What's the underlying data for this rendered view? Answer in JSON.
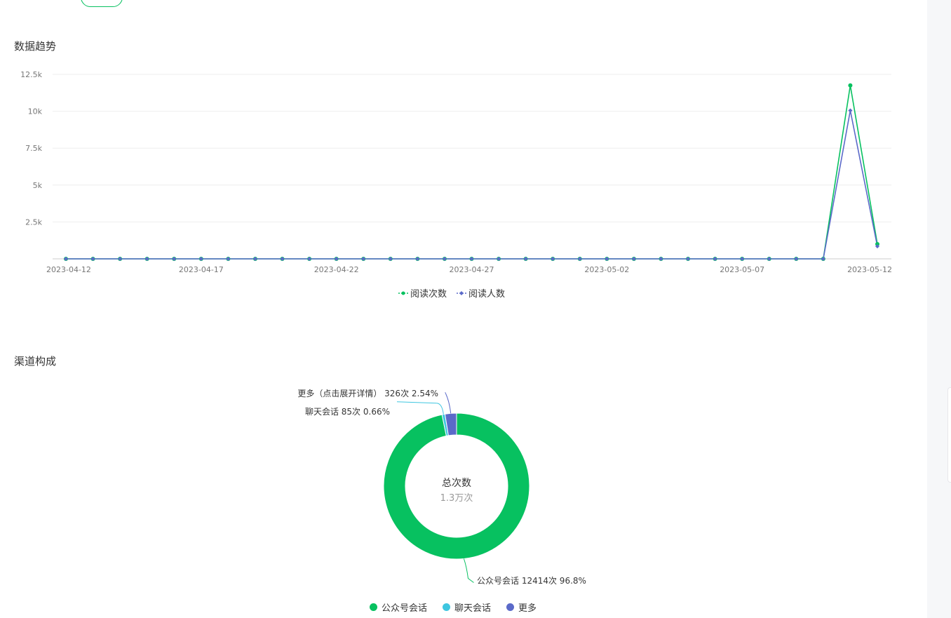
{
  "sections": {
    "trend_title": "数据趋势",
    "channel_title": "渠道构成"
  },
  "colors": {
    "green": "#07c160",
    "indigo": "#5b6ac9",
    "cyan": "#3ec6e0",
    "grid": "#eeeeee",
    "axis": "#cccccc",
    "tick_text": "#777777"
  },
  "chart_data": [
    {
      "type": "line",
      "x": [
        "2023-04-12",
        "2023-04-13",
        "2023-04-14",
        "2023-04-15",
        "2023-04-16",
        "2023-04-17",
        "2023-04-18",
        "2023-04-19",
        "2023-04-20",
        "2023-04-21",
        "2023-04-22",
        "2023-04-23",
        "2023-04-24",
        "2023-04-25",
        "2023-04-26",
        "2023-04-27",
        "2023-04-28",
        "2023-04-29",
        "2023-04-30",
        "2023-05-01",
        "2023-05-02",
        "2023-05-03",
        "2023-05-04",
        "2023-05-05",
        "2023-05-06",
        "2023-05-07",
        "2023-05-08",
        "2023-05-09",
        "2023-05-10",
        "2023-05-11",
        "2023-05-12"
      ],
      "x_tick_labels": [
        "2023-04-12",
        "2023-04-17",
        "2023-04-22",
        "2023-04-27",
        "2023-05-02",
        "2023-05-07",
        "2023-05-12"
      ],
      "y_ticks": [
        2500,
        5000,
        7500,
        10000,
        12500
      ],
      "y_tick_labels": [
        "2.5k",
        "5k",
        "7.5k",
        "10k",
        "12.5k"
      ],
      "ylim": [
        0,
        12500
      ],
      "grid": true,
      "legend_position": "bottom-center",
      "series": [
        {
          "name": "阅读次数",
          "color": "#07c160",
          "marker": "circle",
          "values": [
            0,
            0,
            0,
            0,
            0,
            0,
            0,
            0,
            0,
            0,
            0,
            0,
            0,
            0,
            0,
            0,
            0,
            0,
            0,
            0,
            0,
            0,
            0,
            0,
            0,
            0,
            0,
            0,
            0,
            11750,
            1000
          ]
        },
        {
          "name": "阅读人数",
          "color": "#5b6ac9",
          "marker": "diamond",
          "values": [
            0,
            0,
            0,
            0,
            0,
            0,
            0,
            0,
            0,
            0,
            0,
            0,
            0,
            0,
            0,
            0,
            0,
            0,
            0,
            0,
            0,
            0,
            0,
            0,
            0,
            0,
            0,
            0,
            0,
            10050,
            850
          ]
        }
      ]
    },
    {
      "type": "pie",
      "style": "donut",
      "center_title": "总次数",
      "center_value": "1.3万次",
      "slices": [
        {
          "name": "公众号会话",
          "value": 12414,
          "percent": 96.8,
          "color": "#07c160",
          "label": "公众号会话 12414次 96.8%"
        },
        {
          "name": "聊天会话",
          "value": 85,
          "percent": 0.66,
          "color": "#3ec6e0",
          "label": "聊天会话 85次 0.66%"
        },
        {
          "name": "更多",
          "value": 326,
          "percent": 2.54,
          "color": "#5b6ac9",
          "label": "更多（点击展开详情） 326次 2.54%"
        }
      ],
      "legend_position": "bottom-center"
    }
  ]
}
